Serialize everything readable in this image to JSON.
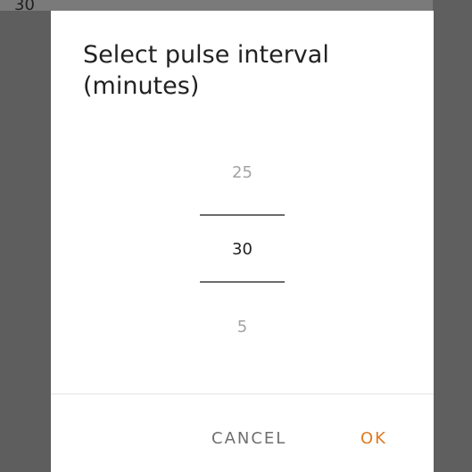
{
  "background": {
    "value_text": "30"
  },
  "dialog": {
    "title": "Select pulse interval\n(minutes)",
    "picker": {
      "previous_value": "25",
      "selected_value": "30",
      "next_value": "5"
    },
    "buttons": {
      "cancel_label": "CANCEL",
      "ok_label": "OK"
    }
  },
  "colors": {
    "accent": "#e07a1f",
    "scrim": "#5e5e5e",
    "dialog_bg": "#ffffff"
  }
}
